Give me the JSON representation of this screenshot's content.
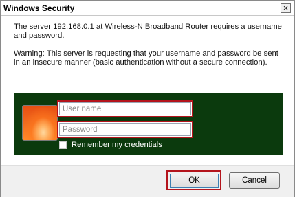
{
  "window": {
    "title": "Windows Security",
    "close_label": "×"
  },
  "message": {
    "line1": "The server 192.168.0.1 at Wireless-N Broadband Router requires a username and password.",
    "warning": "Warning: This server is requesting that your username and password be sent in an insecure manner (basic authentication without a secure connection)."
  },
  "credentials": {
    "username_placeholder": "User name",
    "username_value": "",
    "password_placeholder": "Password",
    "password_value": "",
    "remember_label": "Remember my credentials",
    "remember_checked": false
  },
  "buttons": {
    "ok_label": "OK",
    "cancel_label": "Cancel"
  },
  "colors": {
    "panel": "#0b3a0d",
    "highlight": "#b4141c"
  },
  "icons": {
    "avatar": "user-avatar-tile",
    "close": "close-icon"
  }
}
